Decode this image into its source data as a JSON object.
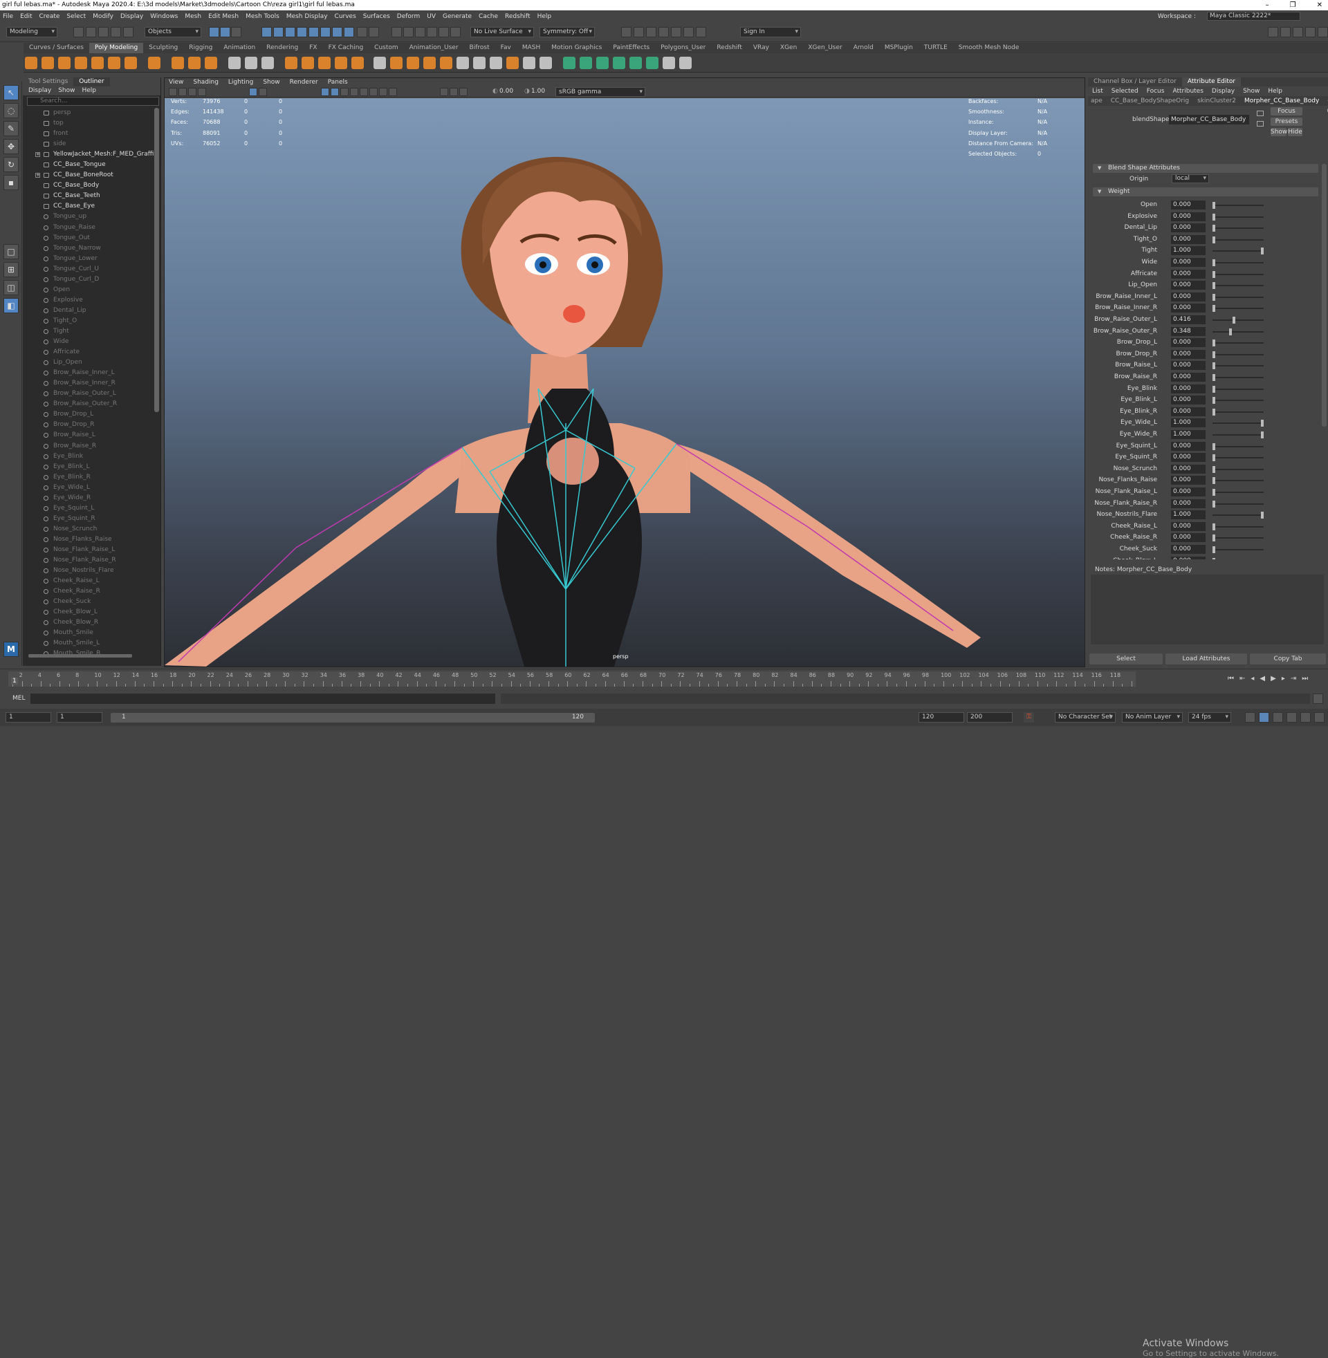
{
  "window": {
    "title": "girl ful lebas.ma* - Autodesk Maya 2020.4: E:\\3d models\\Market\\3dmodels\\Cartoon Ch\\reza girl1\\girl ful lebas.ma",
    "controls": [
      "–",
      "❐",
      "✕"
    ]
  },
  "menubar": {
    "items": [
      "File",
      "Edit",
      "Create",
      "Select",
      "Modify",
      "Display",
      "Windows",
      "Mesh",
      "Edit Mesh",
      "Mesh Tools",
      "Mesh Display",
      "Curves",
      "Surfaces",
      "Deform",
      "UV",
      "Generate",
      "Cache",
      "Redshift",
      "Help"
    ],
    "workspace_label": "Workspace :",
    "workspace_value": "Maya Classic 2222*"
  },
  "statusline": {
    "mode": "Modeling",
    "objects": "Objects",
    "live_surface": "No Live Surface",
    "symmetry": "Symmetry: Off",
    "sign_in": "Sign In"
  },
  "shelf": {
    "tabs": [
      "Curves / Surfaces",
      "Poly Modeling",
      "Sculpting",
      "Rigging",
      "Animation",
      "Rendering",
      "FX",
      "FX Caching",
      "Custom",
      "Animation_User",
      "Bifrost",
      "Fav",
      "MASH",
      "Motion Graphics",
      "PaintEffects",
      "Polygons_User",
      "Redshift",
      "VRay",
      "XGen",
      "XGen_User",
      "Arnold",
      "MSPlugin",
      "TURTLE",
      "Smooth Mesh Node"
    ],
    "active_tab": "Poly Modeling"
  },
  "outliner": {
    "tabs": [
      "Tool Settings",
      "Outliner"
    ],
    "menu": [
      "Display",
      "Show",
      "Help"
    ],
    "search_placeholder": "Search...",
    "items": [
      {
        "label": "persp",
        "dim": true
      },
      {
        "label": "top",
        "dim": true
      },
      {
        "label": "front",
        "dim": true
      },
      {
        "label": "side",
        "dim": true
      },
      {
        "label": "YellowJacket_Mesh:F_MED_Graffiti_As",
        "dim": false,
        "expand": true
      },
      {
        "label": "CC_Base_Tongue",
        "dim": false
      },
      {
        "label": "CC_Base_BoneRoot",
        "dim": false,
        "expand": true
      },
      {
        "label": "CC_Base_Body",
        "dim": false
      },
      {
        "label": "CC_Base_Teeth",
        "dim": false
      },
      {
        "label": "CC_Base_Eye",
        "dim": false
      },
      {
        "label": "Tongue_up",
        "dim": true
      },
      {
        "label": "Tongue_Raise",
        "dim": true
      },
      {
        "label": "Tongue_Out",
        "dim": true
      },
      {
        "label": "Tongue_Narrow",
        "dim": true
      },
      {
        "label": "Tongue_Lower",
        "dim": true
      },
      {
        "label": "Tongue_Curl_U",
        "dim": true
      },
      {
        "label": "Tongue_Curl_D",
        "dim": true
      },
      {
        "label": "Open",
        "dim": true
      },
      {
        "label": "Explosive",
        "dim": true
      },
      {
        "label": "Dental_Lip",
        "dim": true
      },
      {
        "label": "Tight_O",
        "dim": true
      },
      {
        "label": "Tight",
        "dim": true
      },
      {
        "label": "Wide",
        "dim": true
      },
      {
        "label": "Affricate",
        "dim": true
      },
      {
        "label": "Lip_Open",
        "dim": true
      },
      {
        "label": "Brow_Raise_Inner_L",
        "dim": true
      },
      {
        "label": "Brow_Raise_Inner_R",
        "dim": true
      },
      {
        "label": "Brow_Raise_Outer_L",
        "dim": true
      },
      {
        "label": "Brow_Raise_Outer_R",
        "dim": true
      },
      {
        "label": "Brow_Drop_L",
        "dim": true
      },
      {
        "label": "Brow_Drop_R",
        "dim": true
      },
      {
        "label": "Brow_Raise_L",
        "dim": true
      },
      {
        "label": "Brow_Raise_R",
        "dim": true
      },
      {
        "label": "Eye_Blink",
        "dim": true
      },
      {
        "label": "Eye_Blink_L",
        "dim": true
      },
      {
        "label": "Eye_Blink_R",
        "dim": true
      },
      {
        "label": "Eye_Wide_L",
        "dim": true
      },
      {
        "label": "Eye_Wide_R",
        "dim": true
      },
      {
        "label": "Eye_Squint_L",
        "dim": true
      },
      {
        "label": "Eye_Squint_R",
        "dim": true
      },
      {
        "label": "Nose_Scrunch",
        "dim": true
      },
      {
        "label": "Nose_Flanks_Raise",
        "dim": true
      },
      {
        "label": "Nose_Flank_Raise_L",
        "dim": true
      },
      {
        "label": "Nose_Flank_Raise_R",
        "dim": true
      },
      {
        "label": "Nose_Nostrils_Flare",
        "dim": true
      },
      {
        "label": "Cheek_Raise_L",
        "dim": true
      },
      {
        "label": "Cheek_Raise_R",
        "dim": true
      },
      {
        "label": "Cheek_Suck",
        "dim": true
      },
      {
        "label": "Cheek_Blow_L",
        "dim": true
      },
      {
        "label": "Cheek_Blow_R",
        "dim": true
      },
      {
        "label": "Mouth_Smile",
        "dim": true
      },
      {
        "label": "Mouth_Smile_L",
        "dim": true
      },
      {
        "label": "Mouth_Smile_R",
        "dim": true
      }
    ]
  },
  "viewport": {
    "menu": [
      "View",
      "Shading",
      "Lighting",
      "Show",
      "Renderer",
      "Panels"
    ],
    "exposure": "0.00",
    "gamma": "1.00",
    "color_space": "sRGB gamma",
    "camera": "persp",
    "hud_left": [
      {
        "label": "Verts:",
        "v1": "73976",
        "v2": "0",
        "v3": "0"
      },
      {
        "label": "Edges:",
        "v1": "141438",
        "v2": "0",
        "v3": "0"
      },
      {
        "label": "Faces:",
        "v1": "70688",
        "v2": "0",
        "v3": "0"
      },
      {
        "label": "Tris:",
        "v1": "88091",
        "v2": "0",
        "v3": "0"
      },
      {
        "label": "UVs:",
        "v1": "76052",
        "v2": "0",
        "v3": "0"
      }
    ],
    "hud_right": [
      {
        "label": "Backfaces:",
        "value": "N/A"
      },
      {
        "label": "Smoothness:",
        "value": "N/A"
      },
      {
        "label": "Instance:",
        "value": "N/A"
      },
      {
        "label": "Display Layer:",
        "value": "N/A"
      },
      {
        "label": "Distance From Camera:",
        "value": "N/A"
      },
      {
        "label": "Selected Objects:",
        "value": "0"
      }
    ]
  },
  "attribute_editor": {
    "tabs": [
      "Channel Box / Layer Editor",
      "Attribute Editor"
    ],
    "menu": [
      "List",
      "Selected",
      "Focus",
      "Attributes",
      "Display",
      "Show",
      "Help"
    ],
    "node_tabs": [
      "ape",
      "CC_Base_BodyShapeOrig",
      "skinCluster2",
      "Morpher_CC_Base_Body"
    ],
    "blendshape_label": "blendShape:",
    "blendshape_value": "Morpher_CC_Base_Body",
    "buttons": {
      "focus": "Focus",
      "presets": "Presets",
      "show": "Show",
      "hide": "Hide"
    },
    "section_blend": "Blend Shape Attributes",
    "origin_label": "Origin",
    "origin_value": "local",
    "section_weight": "Weight",
    "weights": [
      {
        "name": "Open",
        "value": "0.000",
        "f": 0
      },
      {
        "name": "Explosive",
        "value": "0.000",
        "f": 0
      },
      {
        "name": "Dental_Lip",
        "value": "0.000",
        "f": 0
      },
      {
        "name": "Tight_O",
        "value": "0.000",
        "f": 0
      },
      {
        "name": "Tight",
        "value": "1.000",
        "f": 1
      },
      {
        "name": "Wide",
        "value": "0.000",
        "f": 0
      },
      {
        "name": "Affricate",
        "value": "0.000",
        "f": 0
      },
      {
        "name": "Lip_Open",
        "value": "0.000",
        "f": 0
      },
      {
        "name": "Brow_Raise_Inner_L",
        "value": "0.000",
        "f": 0
      },
      {
        "name": "Brow_Raise_Inner_R",
        "value": "0.000",
        "f": 0
      },
      {
        "name": "Brow_Raise_Outer_L",
        "value": "0.416",
        "f": 0.416
      },
      {
        "name": "Brow_Raise_Outer_R",
        "value": "0.348",
        "f": 0.348
      },
      {
        "name": "Brow_Drop_L",
        "value": "0.000",
        "f": 0
      },
      {
        "name": "Brow_Drop_R",
        "value": "0.000",
        "f": 0
      },
      {
        "name": "Brow_Raise_L",
        "value": "0.000",
        "f": 0
      },
      {
        "name": "Brow_Raise_R",
        "value": "0.000",
        "f": 0
      },
      {
        "name": "Eye_Blink",
        "value": "0.000",
        "f": 0
      },
      {
        "name": "Eye_Blink_L",
        "value": "0.000",
        "f": 0
      },
      {
        "name": "Eye_Blink_R",
        "value": "0.000",
        "f": 0
      },
      {
        "name": "Eye_Wide_L",
        "value": "1.000",
        "f": 1
      },
      {
        "name": "Eye_Wide_R",
        "value": "1.000",
        "f": 1
      },
      {
        "name": "Eye_Squint_L",
        "value": "0.000",
        "f": 0
      },
      {
        "name": "Eye_Squint_R",
        "value": "0.000",
        "f": 0
      },
      {
        "name": "Nose_Scrunch",
        "value": "0.000",
        "f": 0
      },
      {
        "name": "Nose_Flanks_Raise",
        "value": "0.000",
        "f": 0
      },
      {
        "name": "Nose_Flank_Raise_L",
        "value": "0.000",
        "f": 0
      },
      {
        "name": "Nose_Flank_Raise_R",
        "value": "0.000",
        "f": 0
      },
      {
        "name": "Nose_Nostrils_Flare",
        "value": "1.000",
        "f": 1
      },
      {
        "name": "Cheek_Raise_L",
        "value": "0.000",
        "f": 0
      },
      {
        "name": "Cheek_Raise_R",
        "value": "0.000",
        "f": 0
      },
      {
        "name": "Cheek_Suck",
        "value": "0.000",
        "f": 0
      },
      {
        "name": "Cheek_Blow_L",
        "value": "0.000",
        "f": 0
      }
    ],
    "notes_label": "Notes:  Morpher_CC_Base_Body",
    "bottom_buttons": [
      "Select",
      "Load Attributes",
      "Copy Tab"
    ]
  },
  "timeline": {
    "ticks": [
      "2",
      "4",
      "6",
      "8",
      "10",
      "12",
      "14",
      "16",
      "18",
      "20",
      "22",
      "24",
      "26",
      "28",
      "30",
      "32",
      "34",
      "36",
      "38",
      "40",
      "42",
      "44",
      "46",
      "48",
      "50",
      "52",
      "54",
      "56",
      "58",
      "60",
      "62",
      "64",
      "66",
      "68",
      "70",
      "72",
      "74",
      "76",
      "78",
      "80",
      "82",
      "84",
      "86",
      "88",
      "90",
      "92",
      "94",
      "96",
      "98",
      "100",
      "102",
      "104",
      "106",
      "108",
      "110",
      "112",
      "114",
      "116",
      "118"
    ],
    "current_frame": "1"
  },
  "mel": {
    "label": "MEL"
  },
  "range": {
    "start": "1",
    "start2": "1",
    "slider_start": "1",
    "slider_end": "120",
    "end": "120",
    "end2": "200",
    "char_set": "No Character Set",
    "anim_layer": "No Anim Layer",
    "fps": "24 fps"
  },
  "watermark": {
    "line1": "Activate Windows",
    "line2": "Go to Settings to activate Windows."
  },
  "colors": {
    "accent_blue": "#5285c4",
    "shelf_orange": "#d9822b"
  }
}
